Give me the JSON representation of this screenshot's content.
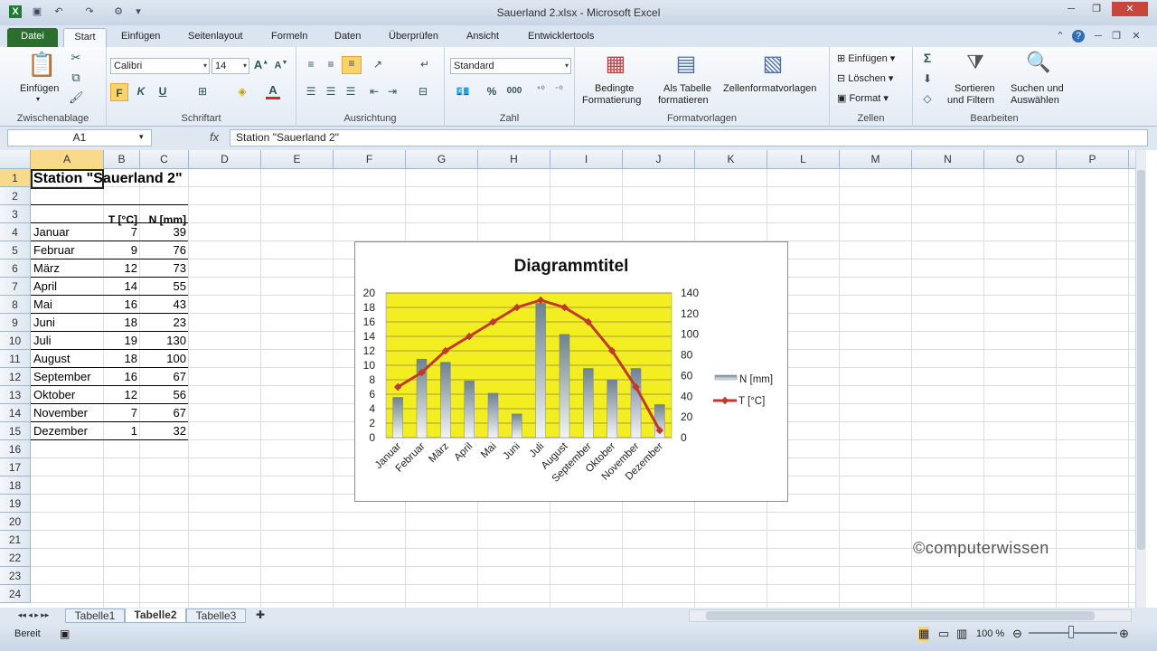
{
  "window": {
    "title": "Sauerland 2.xlsx - Microsoft Excel"
  },
  "ribbon_tabs": [
    "Datei",
    "Start",
    "Einfügen",
    "Seitenlayout",
    "Formeln",
    "Daten",
    "Überprüfen",
    "Ansicht",
    "Entwicklertools"
  ],
  "ribbon": {
    "clipboard": {
      "label": "Zwischenablage",
      "paste": "Einfügen"
    },
    "font": {
      "label": "Schriftart",
      "name": "Calibri",
      "size": "14",
      "bold": "F",
      "italic": "K",
      "underline": "U"
    },
    "alignment": {
      "label": "Ausrichtung"
    },
    "number": {
      "label": "Zahl",
      "format": "Standard",
      "percent": "%",
      "thousands": "000"
    },
    "styles": {
      "label": "Formatvorlagen",
      "cond1": "Bedingte",
      "cond2": "Formatierung",
      "table1": "Als Tabelle",
      "table2": "formatieren",
      "cell": "Zellenformatvorlagen"
    },
    "cells": {
      "label": "Zellen",
      "insert": "Einfügen",
      "delete": "Löschen",
      "format": "Format"
    },
    "editing": {
      "label": "Bearbeiten",
      "sort1": "Sortieren",
      "sort2": "und Filtern",
      "find1": "Suchen und",
      "find2": "Auswählen"
    }
  },
  "formula_bar": {
    "name_box": "A1",
    "fx": "fx",
    "formula": "Station \"Sauerland 2\""
  },
  "columns": [
    "A",
    "B",
    "C",
    "D",
    "E",
    "F",
    "G",
    "H",
    "I",
    "J",
    "K",
    "L",
    "M",
    "N",
    "O",
    "P"
  ],
  "rows": [
    "1",
    "2",
    "3",
    "4",
    "5",
    "6",
    "7",
    "8",
    "9",
    "10",
    "11",
    "12",
    "13",
    "14",
    "15",
    "16",
    "17",
    "18",
    "19",
    "20",
    "21",
    "22",
    "23",
    "24"
  ],
  "sheet": {
    "title": "Station \"Sauerland 2\"",
    "header_t": "T [°C]",
    "header_n": "N [mm]",
    "data": [
      {
        "month": "Januar",
        "t": "7",
        "n": "39"
      },
      {
        "month": "Februar",
        "t": "9",
        "n": "76"
      },
      {
        "month": "März",
        "t": "12",
        "n": "73"
      },
      {
        "month": "April",
        "t": "14",
        "n": "55"
      },
      {
        "month": "Mai",
        "t": "16",
        "n": "43"
      },
      {
        "month": "Juni",
        "t": "18",
        "n": "23"
      },
      {
        "month": "Juli",
        "t": "19",
        "n": "130"
      },
      {
        "month": "August",
        "t": "18",
        "n": "100"
      },
      {
        "month": "September",
        "t": "16",
        "n": "67"
      },
      {
        "month": "Oktober",
        "t": "12",
        "n": "56"
      },
      {
        "month": "November",
        "t": "7",
        "n": "67"
      },
      {
        "month": "Dezember",
        "t": "1",
        "n": "32"
      }
    ]
  },
  "chart_data": {
    "type": "bar",
    "title": "Diagrammtitel",
    "categories": [
      "Januar",
      "Februar",
      "März",
      "April",
      "Mai",
      "Juni",
      "Juli",
      "August",
      "September",
      "Oktober",
      "November",
      "Dezember"
    ],
    "series": [
      {
        "name": "N [mm]",
        "kind": "bar",
        "axis": "secondary",
        "color": "#8a9ba6",
        "values": [
          39,
          76,
          73,
          55,
          43,
          23,
          130,
          100,
          67,
          56,
          67,
          32
        ]
      },
      {
        "name": "T [°C]",
        "kind": "line",
        "axis": "primary",
        "color": "#c0392b",
        "values": [
          7,
          9,
          12,
          14,
          16,
          18,
          19,
          18,
          16,
          12,
          7,
          1
        ]
      }
    ],
    "y_primary": {
      "range": [
        0,
        20
      ],
      "ticks": [
        "0",
        "2",
        "4",
        "6",
        "8",
        "10",
        "12",
        "14",
        "16",
        "18",
        "20"
      ]
    },
    "y_secondary": {
      "range": [
        0,
        140
      ],
      "ticks": [
        "0",
        "20",
        "40",
        "60",
        "80",
        "100",
        "120",
        "140"
      ]
    },
    "plot_background": "#f3ee22",
    "grid": true,
    "legend": "right"
  },
  "watermark": "©computerwissen",
  "sheet_tabs": [
    "Tabelle1",
    "Tabelle2",
    "Tabelle3"
  ],
  "active_sheet": "Tabelle2",
  "status": {
    "ready": "Bereit",
    "zoom": "100 %"
  }
}
